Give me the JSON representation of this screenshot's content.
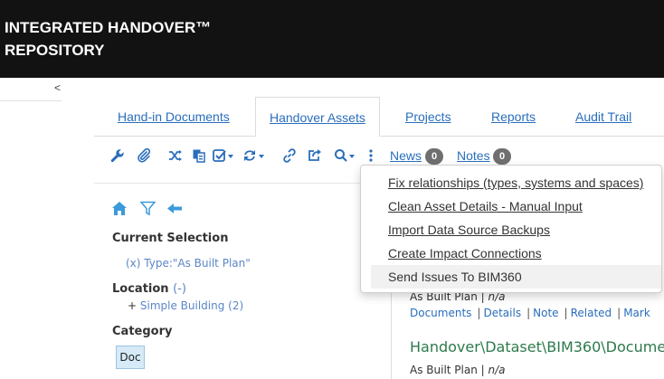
{
  "app": {
    "title_line1": "INTEGRATED HANDOVER™",
    "title_line2": "REPOSITORY"
  },
  "sidebar": {
    "collapse_glyph": "<"
  },
  "tabs": [
    {
      "label": "Hand-in Documents"
    },
    {
      "label": "Handover Assets",
      "active": true
    },
    {
      "label": "Projects"
    },
    {
      "label": "Reports"
    },
    {
      "label": "Audit Trail"
    }
  ],
  "toolbar": {
    "icons": [
      "wrench-icon",
      "paperclip-icon",
      "shuffle-icon",
      "copy-icon",
      "check-square-icon",
      "refresh-icon",
      "link-icon",
      "export-icon",
      "search-icon",
      "more-vertical-icon"
    ],
    "news_label": "News",
    "news_count": "0",
    "notes_label": "Notes",
    "notes_count": "0"
  },
  "filters": {
    "current_selection_title": "Current Selection",
    "current_selection_value": "(x) Type:\"As Built Plan\"",
    "location_title": "Location",
    "location_toggle": "(-)",
    "location_prefix": "+",
    "location_value": "Simple Building (2)",
    "category_title": "Category",
    "category_chip": "Doc"
  },
  "results": {
    "item1_type": "As Built Plan",
    "item1_sep": " | ",
    "item1_na": "n/a",
    "links": [
      "Documents",
      "Details",
      "Note",
      "Related",
      "Mark"
    ],
    "item2_path": "Handover\\Dataset\\BIM360\\Docume",
    "item2_type": "As Built Plan",
    "item2_na": "n/a"
  },
  "menu": {
    "items": [
      {
        "label": "Fix relationships (types, systems and spaces)"
      },
      {
        "label": "Clean Asset Details - Manual Input"
      },
      {
        "label": "Import Data Source Backups"
      },
      {
        "label": "Create Impact Connections"
      },
      {
        "label": "Send Issues To BIM360",
        "hovered": true
      }
    ]
  },
  "colors": {
    "header_bg": "#121212",
    "link": "#2a6ebb",
    "filter_link": "#5b86c6",
    "path_green": "#2d7a4b",
    "chip_bg": "#d6ebf7"
  }
}
